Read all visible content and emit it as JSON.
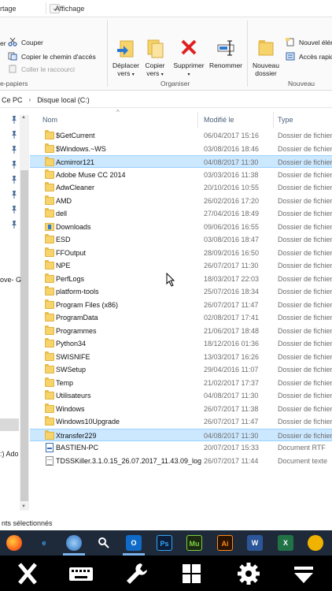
{
  "ribbon_tabs": {
    "share": "rtage",
    "view": "Affichage"
  },
  "ribbon": {
    "clipboard": {
      "cut": "Couper",
      "copy_path": "Copier le chemin d'accès",
      "paste_shortcut": "Coller le raccourci",
      "group_label": "e-papiers",
      "truncated": "er"
    },
    "organize": {
      "move_to": "Déplacer",
      "move_to_2": "vers",
      "copy_to": "Copier",
      "copy_to_2": "vers",
      "delete": "Supprimer",
      "rename": "Renommer",
      "group_label": "Organiser"
    },
    "new": {
      "new_folder": "Nouveau",
      "new_folder_2": "dossier",
      "new_item": "Nouvel élém",
      "easy_access": "Accès rapid",
      "group_label": "Nouveau"
    }
  },
  "address": {
    "this_pc": "Ce PC",
    "drive": "Disque local (C:)"
  },
  "nav": {
    "item_a": "ove- G",
    "item_b": ":) Ado"
  },
  "columns": {
    "name": "Nom",
    "modified": "Modifié le",
    "type": "Type"
  },
  "files": [
    {
      "name": "$GetCurrent",
      "date": "06/04/2017 15:16",
      "type": "Dossier de fichiers",
      "icon": "folder",
      "selected": false
    },
    {
      "name": "$Windows.~WS",
      "date": "03/08/2016 18:46",
      "type": "Dossier de fichiers",
      "icon": "folder",
      "selected": false
    },
    {
      "name": "Acmirror121",
      "date": "04/08/2017 11:30",
      "type": "Dossier de fichiers",
      "icon": "folder",
      "selected": true
    },
    {
      "name": "Adobe Muse CC 2014",
      "date": "03/03/2016 11:38",
      "type": "Dossier de fichiers",
      "icon": "folder",
      "selected": false
    },
    {
      "name": "AdwCleaner",
      "date": "20/10/2016 10:55",
      "type": "Dossier de fichiers",
      "icon": "folder",
      "selected": false
    },
    {
      "name": "AMD",
      "date": "26/02/2016 17:20",
      "type": "Dossier de fichiers",
      "icon": "folder",
      "selected": false
    },
    {
      "name": "dell",
      "date": "27/04/2016 18:49",
      "type": "Dossier de fichiers",
      "icon": "folder",
      "selected": false
    },
    {
      "name": "Downloads",
      "date": "09/06/2016 16:55",
      "type": "Dossier de fichiers",
      "icon": "folder-download",
      "selected": false
    },
    {
      "name": "ESD",
      "date": "03/08/2016 18:47",
      "type": "Dossier de fichiers",
      "icon": "folder",
      "selected": false
    },
    {
      "name": "FFOutput",
      "date": "28/09/2016 16:50",
      "type": "Dossier de fichiers",
      "icon": "folder",
      "selected": false
    },
    {
      "name": "NPE",
      "date": "26/07/2017 11:30",
      "type": "Dossier de fichiers",
      "icon": "folder",
      "selected": false
    },
    {
      "name": "PerfLogs",
      "date": "18/03/2017 22:03",
      "type": "Dossier de fichiers",
      "icon": "folder",
      "selected": false
    },
    {
      "name": "platform-tools",
      "date": "25/07/2016 18:34",
      "type": "Dossier de fichiers",
      "icon": "folder",
      "selected": false
    },
    {
      "name": "Program Files (x86)",
      "date": "26/07/2017 11:47",
      "type": "Dossier de fichiers",
      "icon": "folder",
      "selected": false
    },
    {
      "name": "ProgramData",
      "date": "02/08/2017 17:41",
      "type": "Dossier de fichiers",
      "icon": "folder",
      "selected": false
    },
    {
      "name": "Programmes",
      "date": "21/06/2017 18:48",
      "type": "Dossier de fichiers",
      "icon": "folder",
      "selected": false
    },
    {
      "name": "Python34",
      "date": "18/12/2016 01:36",
      "type": "Dossier de fichiers",
      "icon": "folder",
      "selected": false
    },
    {
      "name": "SWISNIFE",
      "date": "13/03/2017 16:26",
      "type": "Dossier de fichiers",
      "icon": "folder",
      "selected": false
    },
    {
      "name": "SWSetup",
      "date": "29/04/2016 11:07",
      "type": "Dossier de fichiers",
      "icon": "folder",
      "selected": false
    },
    {
      "name": "Temp",
      "date": "21/02/2017 17:37",
      "type": "Dossier de fichiers",
      "icon": "folder",
      "selected": false
    },
    {
      "name": "Utilisateurs",
      "date": "04/08/2017 11:30",
      "type": "Dossier de fichiers",
      "icon": "folder",
      "selected": false
    },
    {
      "name": "Windows",
      "date": "26/07/2017 11:38",
      "type": "Dossier de fichiers",
      "icon": "folder",
      "selected": false
    },
    {
      "name": "Windows10Upgrade",
      "date": "26/07/2017 11:47",
      "type": "Dossier de fichiers",
      "icon": "folder",
      "selected": false
    },
    {
      "name": "Xtransfer229",
      "date": "04/08/2017 11:30",
      "type": "Dossier de fichiers",
      "icon": "folder",
      "selected": true
    },
    {
      "name": "BASTIEN-PC",
      "date": "20/07/2017 15:33",
      "type": "Document RTF",
      "icon": "rtf-document",
      "selected": false
    },
    {
      "name": "TDSSKiller.3.1.0.15_26.07.2017_11.43.09_log",
      "date": "26/07/2017 11:44",
      "type": "Document texte",
      "icon": "text-document",
      "selected": false
    }
  ],
  "status": {
    "selection_text": "nts sélectionnés"
  },
  "taskbar": {
    "apps": [
      {
        "name": "firefox-icon",
        "label": ""
      },
      {
        "name": "internet-explorer-icon",
        "label": "e"
      },
      {
        "name": "globe-app-icon",
        "label": ""
      },
      {
        "name": "magnifier-icon",
        "label": ""
      },
      {
        "name": "outlook-icon",
        "label": "O"
      },
      {
        "name": "photoshop-icon",
        "label": "Ps"
      },
      {
        "name": "muse-icon",
        "label": "Mu"
      },
      {
        "name": "illustrator-icon",
        "label": "Ai"
      },
      {
        "name": "word-icon",
        "label": "W"
      },
      {
        "name": "excel-icon",
        "label": "X"
      },
      {
        "name": "warning-app-icon",
        "label": ""
      }
    ]
  },
  "bottom_bar": {
    "buttons": [
      "close-icon",
      "keyboard-icon",
      "wrench-icon",
      "windows-logo-icon",
      "gear-icon",
      "minimize-down-icon"
    ]
  },
  "colors": {
    "selection_bg": "#cce8ff",
    "selection_border": "#99d1ff",
    "folder": "#f6d36b",
    "column_header_text": "#4c607a",
    "taskbar": "#1e2a3a",
    "tablet_bar": "#000000"
  }
}
